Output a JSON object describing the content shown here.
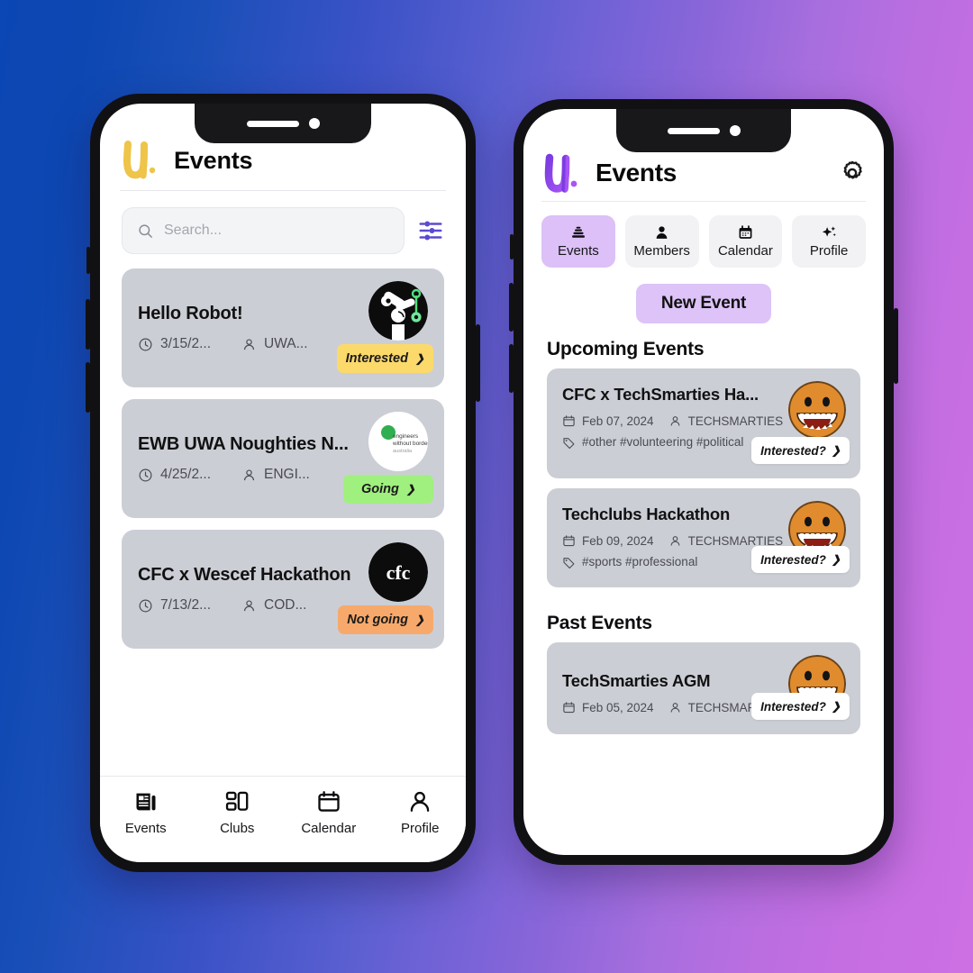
{
  "background": {
    "from": "#0b47b5",
    "to": "#cd70e4"
  },
  "left_phone": {
    "header": {
      "title": "Events",
      "logo_name": "u-logo-yellow",
      "logo_color": "#eec449"
    },
    "search": {
      "placeholder": "Search...",
      "value": "",
      "filter_icon": "filter-sliders-icon",
      "filter_color": "#5b4ad1"
    },
    "events": [
      {
        "title": "Hello Robot!",
        "date": "3/15/2...",
        "host": "UWA...",
        "avatar": "robot-arm-logo",
        "rsvp": {
          "label": "Interested",
          "state": "interested",
          "color": "#fcd96b"
        }
      },
      {
        "title": "EWB UWA Noughties N...",
        "date": "4/25/2...",
        "host": "ENGI...",
        "avatar": "engineers-without-borders-logo",
        "avatar_text": "engineers without borders australia",
        "rsvp": {
          "label": "Going",
          "state": "going",
          "color": "#a0f07f"
        }
      },
      {
        "title": "CFC x Wescef Hackathon",
        "date": "7/13/2...",
        "host": "COD...",
        "avatar": "cfc-logo",
        "avatar_text": "cfc",
        "rsvp": {
          "label": "Not going",
          "state": "notgoing",
          "color": "#f7a96b"
        }
      }
    ],
    "tabbar": [
      {
        "label": "Events",
        "icon": "news-events-icon",
        "active": true
      },
      {
        "label": "Clubs",
        "icon": "grid-clubs-icon",
        "active": false
      },
      {
        "label": "Calendar",
        "icon": "calendar-icon",
        "active": false
      },
      {
        "label": "Profile",
        "icon": "person-icon",
        "active": false
      }
    ]
  },
  "right_phone": {
    "header": {
      "title": "Events",
      "logo_name": "u-logo-purple",
      "logo_color": "#8b4ce0",
      "settings_icon": "gear-icon"
    },
    "tabs": [
      {
        "label": "Events",
        "icon": "layers-events-icon",
        "active": true
      },
      {
        "label": "Members",
        "icon": "person-icon",
        "active": false
      },
      {
        "label": "Calendar",
        "icon": "calendar-icon",
        "active": false
      },
      {
        "label": "Profile",
        "icon": "sparkles-icon",
        "active": false
      }
    ],
    "new_event_button": "New Event",
    "sections": [
      {
        "heading": "Upcoming Events",
        "events": [
          {
            "title": "CFC x TechSmarties Ha...",
            "date": "Feb 07, 2024",
            "host": "TECHSMARTIES",
            "tags": "#other #volunteering #political",
            "avatar": "smiley-face-logo",
            "rsvp": "Interested?"
          },
          {
            "title": "Techclubs Hackathon",
            "date": "Feb 09, 2024",
            "host": "TECHSMARTIES",
            "tags": "#sports #professional",
            "avatar": "smiley-face-logo",
            "rsvp": "Interested?"
          }
        ]
      },
      {
        "heading": "Past Events",
        "events": [
          {
            "title": "TechSmarties AGM",
            "date": "Feb 05, 2024",
            "host": "TECHSMARTIES",
            "tags": "",
            "avatar": "smiley-face-logo",
            "rsvp": "Interested?"
          }
        ]
      }
    ]
  }
}
